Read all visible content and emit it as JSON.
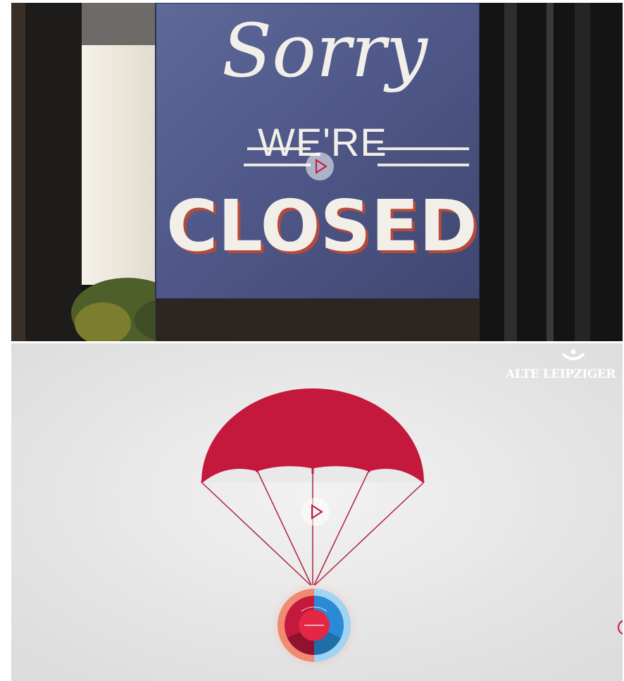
{
  "videos": [
    {
      "sign": {
        "line1": "Sorry",
        "line2": "WE'RE",
        "line3": "CLOSED"
      },
      "play_icon": "play-icon"
    },
    {
      "brand": {
        "name": "ALTE LEIPZIGER",
        "logo_icon": "alte-leipziger-logo-icon"
      },
      "play_icon": "play-icon",
      "colors": {
        "brand_red": "#c4183d",
        "blue": "#2a8ad6"
      }
    }
  ]
}
